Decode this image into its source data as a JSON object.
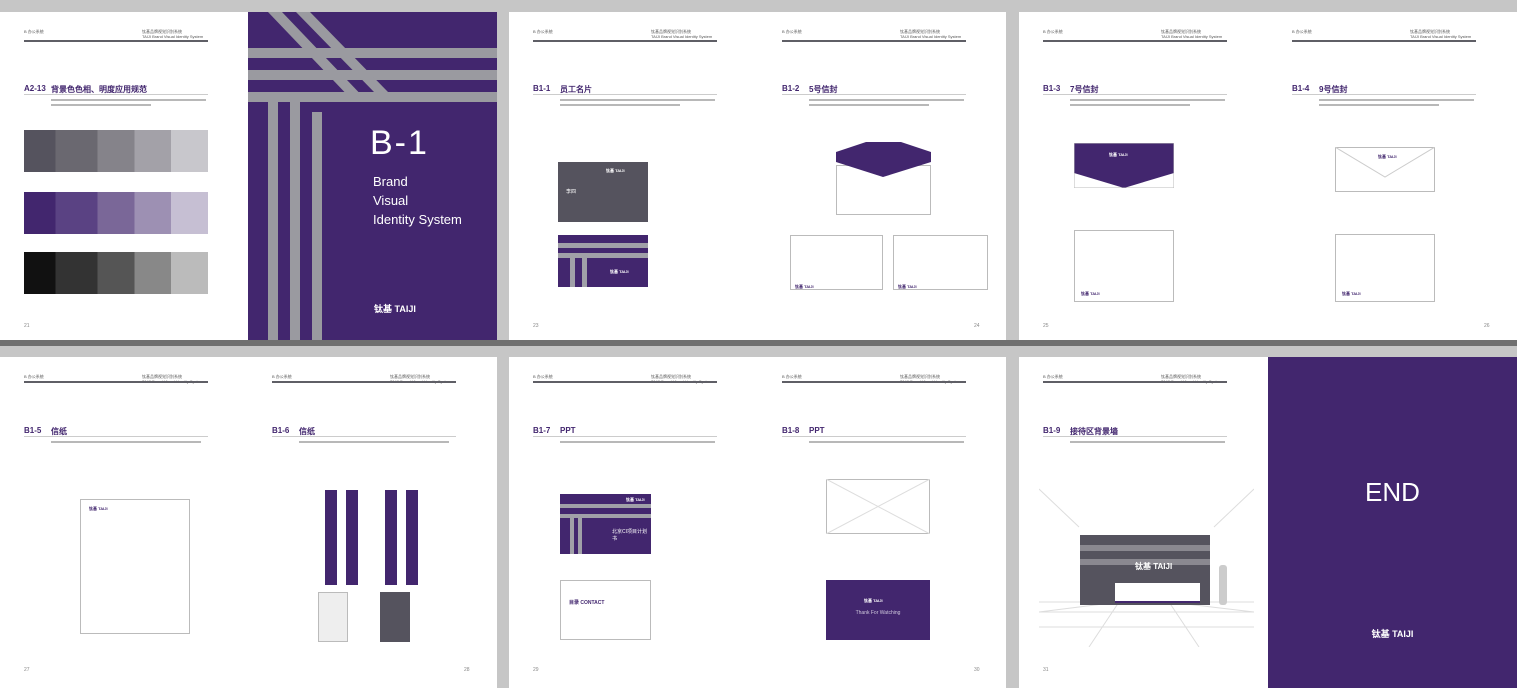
{
  "header": {
    "section_left": "B 办公系统",
    "manual_cn": "钛基品牌视觉识别系统",
    "manual_en": "TAIJI Brand Visual Identity System"
  },
  "brand": {
    "logo_text": "钛基 TAIJI",
    "purple": "#42266e",
    "gray": "#55535e"
  },
  "pages": [
    {
      "code": "A2-13",
      "title": "背景色色相、明度应用规范",
      "number": "21"
    },
    {
      "cover_code": "B-1",
      "cover_lines": [
        "Brand",
        "Visual",
        "Identity System"
      ]
    },
    {
      "code": "B1-1",
      "title": "员工名片",
      "number": "23"
    },
    {
      "code": "B1-2",
      "title": "5号信封",
      "number": "24"
    },
    {
      "code": "B1-3",
      "title": "7号信封",
      "number": "25"
    },
    {
      "code": "B1-4",
      "title": "9号信封",
      "number": "26"
    },
    {
      "code": "B1-5",
      "title": "信纸",
      "number": "27"
    },
    {
      "code": "B1-6",
      "title": "信纸",
      "number": "28"
    },
    {
      "code": "B1-7",
      "title": "PPT",
      "number": "29",
      "slide_title": "北京CI项目计划书",
      "contents_title": "目录 CONTACT"
    },
    {
      "code": "B1-8",
      "title": "PPT",
      "number": "30",
      "end_slide": "Thank For Watching"
    },
    {
      "code": "B1-9",
      "title": "接待区背景墙",
      "number": "31"
    },
    {
      "end_text": "END"
    }
  ],
  "card": {
    "name": "李四"
  }
}
